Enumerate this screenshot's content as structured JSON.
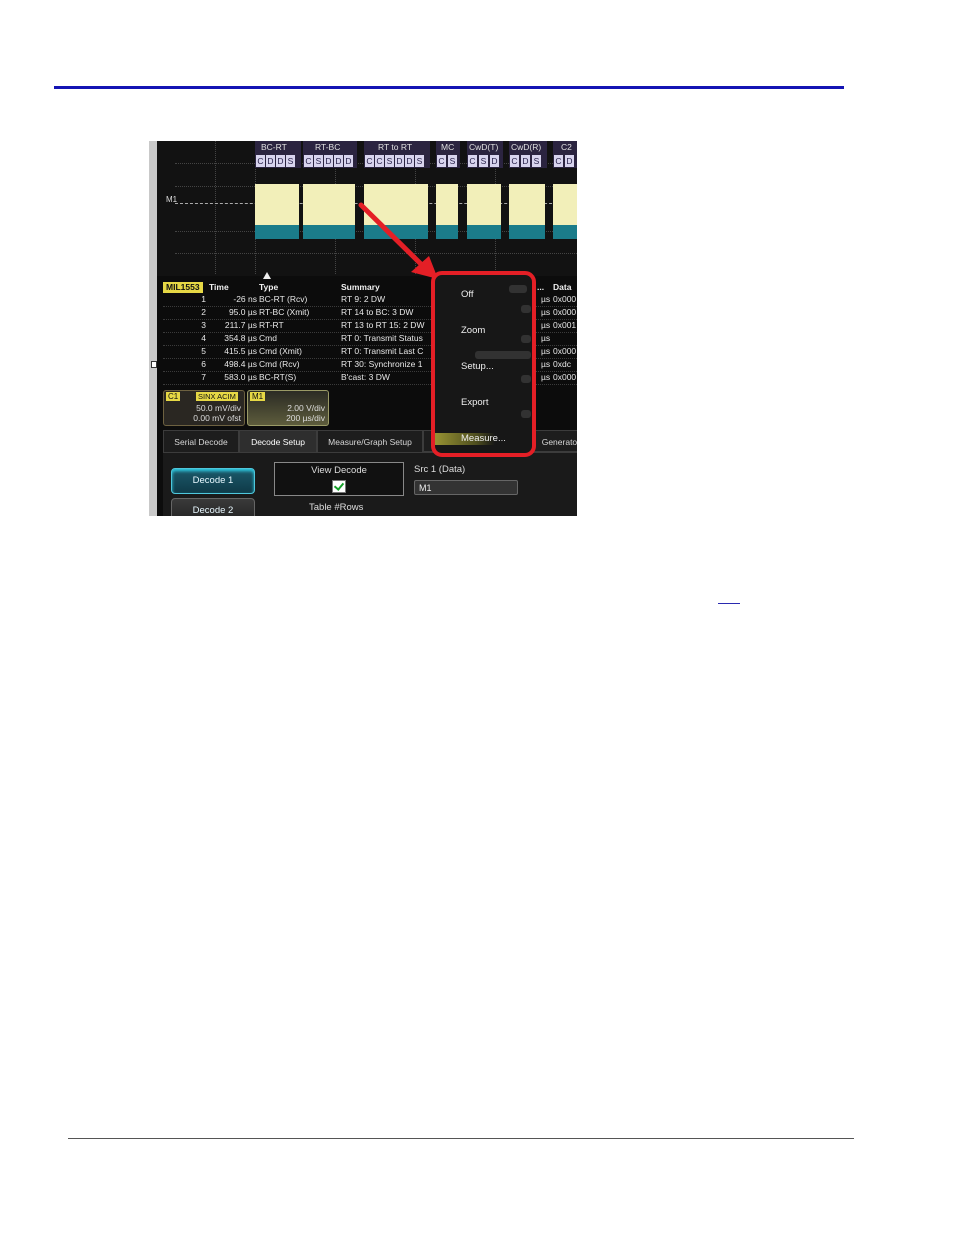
{
  "frames": [
    {
      "name": "BC-RT",
      "words": [
        "C",
        "D",
        "D",
        "S"
      ]
    },
    {
      "name": "RT-BC",
      "words": [
        "C",
        "S",
        "D",
        "D",
        "D"
      ]
    },
    {
      "name": "RT to RT",
      "words": [
        "C",
        "C",
        "S",
        "D",
        "D",
        "S"
      ]
    },
    {
      "name": "MC",
      "words": [
        "C",
        "S"
      ]
    },
    {
      "name": "CwD(T)",
      "words": [
        "C",
        "S",
        "D"
      ]
    },
    {
      "name": "CwD(R)",
      "words": [
        "C",
        "D",
        "S"
      ]
    },
    {
      "name": "C2",
      "words": [
        "C",
        "D"
      ]
    }
  ],
  "trace_label": "M1",
  "table": {
    "protocol": "MIL1553",
    "headers": {
      "time": "Time",
      "type": "Type",
      "summary": "Summary",
      "col5": "...",
      "data": "Data"
    },
    "rows": [
      {
        "index": "1",
        "time": "-26 ns",
        "type": "BC-RT (Rcv)",
        "summary": "RT 9: 2 DW",
        "unit": "µs",
        "data": "0x000"
      },
      {
        "index": "2",
        "time": "95.0 µs",
        "type": "RT-BC (Xmit)",
        "summary": "RT 14 to BC: 3 DW",
        "unit": "µs",
        "data": "0x000"
      },
      {
        "index": "3",
        "time": "211.7 µs",
        "type": "RT-RT",
        "summary": "RT 13 to RT 15: 2 DW",
        "unit": "µs",
        "data": "0x001"
      },
      {
        "index": "4",
        "time": "354.8 µs",
        "type": "Cmd",
        "summary": "RT 0: Transmit Status",
        "unit": "µs",
        "data": ""
      },
      {
        "index": "5",
        "time": "415.5 µs",
        "type": "Cmd (Xmit)",
        "summary": "RT 0: Transmit Last C",
        "unit": "µs",
        "data": "0x000"
      },
      {
        "index": "6",
        "time": "498.4 µs",
        "type": "Cmd (Rcv)",
        "summary": "RT 30: Synchronize 1",
        "unit": "µs",
        "data": "0xdc"
      },
      {
        "index": "7",
        "time": "583.0 µs",
        "type": "BC-RT(S)",
        "summary": "B'cast: 3 DW",
        "unit": "µs",
        "data": "0x000"
      }
    ]
  },
  "descriptors": {
    "c1": {
      "tag": "C1",
      "mode": "SINX ACIM",
      "scale": "50.0 mV/div",
      "offset": "0.00 mV ofst"
    },
    "m1": {
      "tag": "M1",
      "scale": "2.00 V/div",
      "timebase": "200 µs/div"
    }
  },
  "tabs": [
    "Serial Decode",
    "Decode Setup",
    "Measure/Graph Setup",
    "Generator"
  ],
  "active_tab": "Decode Setup",
  "panel": {
    "decode1": "Decode 1",
    "decode2": "Decode 2",
    "view_decode_label": "View Decode",
    "view_decode_checked": true,
    "src1_label": "Src 1 (Data)",
    "src1_value": "M1",
    "table_rows_label": "Table #Rows"
  },
  "context_menu": [
    "Off",
    "Zoom",
    "Setup...",
    "Export",
    "Measure..."
  ],
  "colors": {
    "highlight": "#e41f26",
    "arrow": "#e41f26",
    "rule": "#1414b4",
    "label_yellow": "#e6d845"
  }
}
